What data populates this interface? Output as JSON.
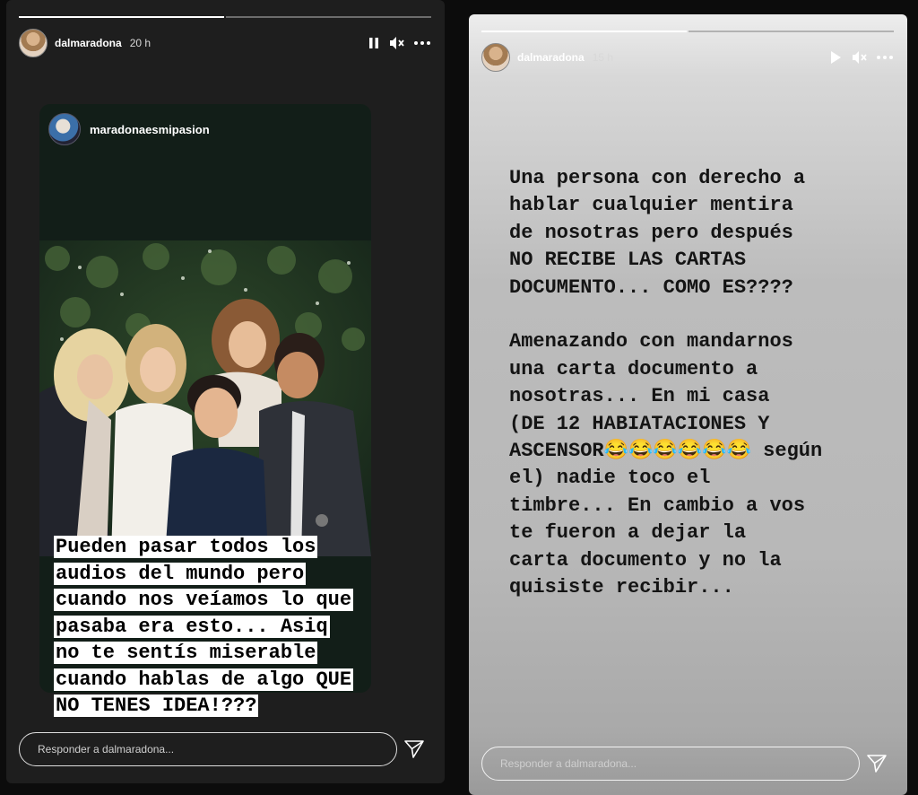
{
  "story_left": {
    "username": "dalmaradona",
    "time_ago": "20 h",
    "progress_segments": [
      1,
      0
    ],
    "playback_icon": "pause-icon",
    "sound_icon": "muted-speaker-icon",
    "repost": {
      "username": "maradonaesmipasion",
      "caption_lines": [
        "Pueden pasar todos los",
        "audios del mundo pero",
        "cuando nos veíamos lo que",
        "pasaba era esto... Asiq",
        "no te sentís miserable",
        "cuando hablas de algo QUE",
        "NO TENES IDEA!???"
      ]
    },
    "reply_placeholder": "Responder a dalmaradona...",
    "send_icon": "send-icon"
  },
  "story_right": {
    "username": "dalmaradona",
    "time_ago": "15 h",
    "progress_segments": [
      1,
      0
    ],
    "playback_icon": "play-icon",
    "sound_icon": "muted-speaker-icon",
    "text": "Una persona con derecho a\nhablar cualquier mentira\nde nosotras pero después\nNO RECIBE LAS CARTAS\nDOCUMENTO... COMO ES????\n\nAmenazando con mandarnos\nuna carta documento a\nnosotras... En mi casa\n(DE 12 HABIATACIONES Y\nASCENSOR😂😂😂😂😂😂 según\nel) nadie toco el\ntimbre... En cambio a vos\nte fueron a dejar la\ncarta documento y no la\nquisiste recibir...",
    "reply_placeholder": "Responder a dalmaradona...",
    "send_icon": "send-icon"
  },
  "colors": {
    "story_bg": "#1e1e1e",
    "card_bg": "#121e18",
    "caption_bg": "#ffffff",
    "text": "#141414"
  }
}
